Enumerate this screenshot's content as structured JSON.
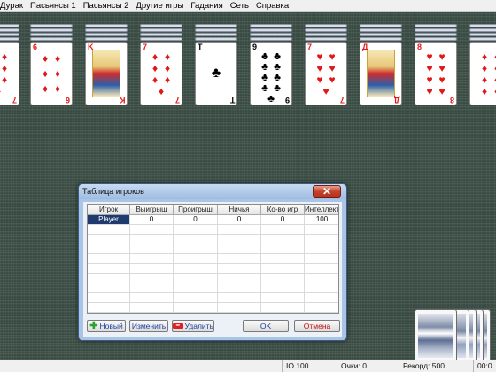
{
  "menu": [
    "Дурак",
    "Пасьянсы 1",
    "Пасьянсы 2",
    "Другие игры",
    "Гадания",
    "Сеть",
    "Справка"
  ],
  "columns": [
    {
      "card": "7",
      "suit": "♦",
      "color": "red",
      "pips": 7
    },
    {
      "card": "6",
      "suit": "♦",
      "color": "red",
      "pips": 6
    },
    {
      "card": "K",
      "suit": "♦",
      "color": "red",
      "face": true
    },
    {
      "card": "7",
      "suit": "♦",
      "color": "red",
      "pips": 7
    },
    {
      "card": "T",
      "suit": "♣",
      "color": "black",
      "pips": 1
    },
    {
      "card": "9",
      "suit": "♣",
      "color": "black",
      "pips": 9
    },
    {
      "card": "7",
      "suit": "♥",
      "color": "red",
      "pips": 7
    },
    {
      "card": "Д",
      "suit": "♥",
      "color": "red",
      "face": true
    },
    {
      "card": "8",
      "suit": "♥",
      "color": "red",
      "pips": 8
    },
    {
      "card": "",
      "suit": "♦",
      "color": "red",
      "pips": 8
    }
  ],
  "dialog": {
    "title": "Таблица игроков",
    "close_glyph": "✕",
    "headers": [
      "Игрок",
      "Выигрыш",
      "Проигрыш",
      "Ничья",
      "Ко-во игр",
      "Интеллект"
    ],
    "rows": [
      [
        "Player",
        "0",
        "0",
        "0",
        "0",
        "100"
      ]
    ],
    "buttons": {
      "new": "Новый",
      "edit": "Изменить",
      "delete": "Удалить",
      "ok": "OK",
      "cancel": "Отмена"
    },
    "icons": {
      "new": "plus-icon",
      "delete": "minus-icon"
    }
  },
  "status": {
    "io": "IO 100",
    "score_label": "Очки:",
    "score_value": "0",
    "record_label": "Рекорд:",
    "record_value": "500",
    "time": "00:0"
  },
  "colors": {
    "felt": "#3c4f46",
    "selection": "#1f3a6e",
    "red_suit": "#e01818"
  }
}
